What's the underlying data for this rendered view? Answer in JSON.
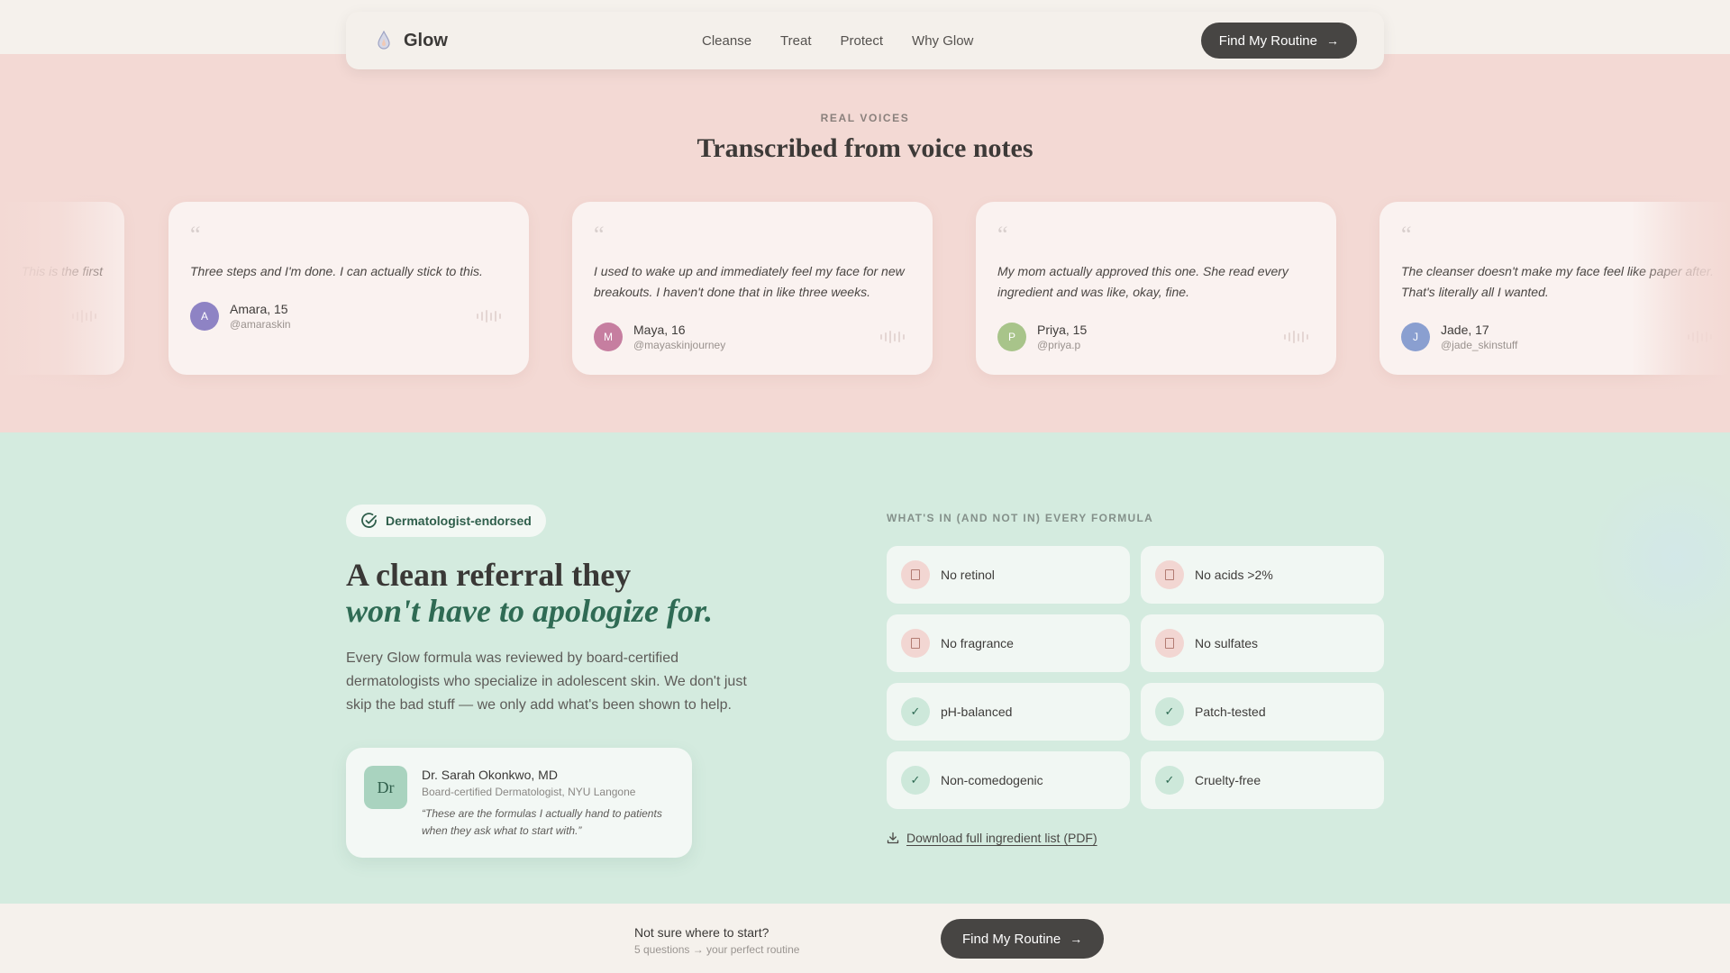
{
  "nav": {
    "brand": "Glow",
    "links": [
      "Cleanse",
      "Treat",
      "Protect",
      "Why Glow"
    ],
    "cta": "Find My Routine"
  },
  "voices": {
    "eyebrow": "REAL VOICES",
    "title": "Transcribed from voice notes",
    "cards": [
      {
        "quote": "This is the first",
        "name": "",
        "handle": "",
        "initial": "",
        "color": "#c98f8a"
      },
      {
        "quote": "Three steps and I'm done. I can actually stick to this.",
        "name": "Amara, 15",
        "handle": "@amaraskin",
        "initial": "A",
        "color": "#8e83c4"
      },
      {
        "quote": "I used to wake up and immediately feel my face for new breakouts. I haven't done that in like three weeks.",
        "name": "Maya, 16",
        "handle": "@mayaskinjourney",
        "initial": "M",
        "color": "#c67ea0"
      },
      {
        "quote": "My mom actually approved this one. She read every ingredient and was like, okay, fine.",
        "name": "Priya, 15",
        "handle": "@priya.p",
        "initial": "P",
        "color": "#a8c48a"
      },
      {
        "quote": "The cleanser doesn't make my face feel like paper after. That's literally all I wanted.",
        "name": "Jade, 17",
        "handle": "@jade_skinstuff",
        "initial": "J",
        "color": "#8a9fd0"
      }
    ]
  },
  "derm": {
    "badge": "Dermatologist-endorsed",
    "title_line1": "A clean referral they",
    "title_line2": "won't have to apologize for.",
    "body": "Every Glow formula was reviewed by board-certified dermatologists who specialize in adolescent skin. We don't just skip the bad stuff — we only add what's been shown to help.",
    "doctor": {
      "initials": "Dr",
      "name": "Dr. Sarah Okonkwo, MD",
      "role": "Board-certified Dermatologist, NYU Langone",
      "quote": "“These are the formulas I actually hand to patients when they ask what to start with.”"
    },
    "formula_eyebrow": "WHAT'S IN (AND NOT IN) EVERY FORMULA",
    "formula": [
      {
        "label": "No retinol",
        "kind": "neg"
      },
      {
        "label": "No acids >2%",
        "kind": "neg"
      },
      {
        "label": "No fragrance",
        "kind": "neg"
      },
      {
        "label": "No sulfates",
        "kind": "neg"
      },
      {
        "label": "pH-balanced",
        "kind": "pos"
      },
      {
        "label": "Patch-tested",
        "kind": "pos"
      },
      {
        "label": "Non-comedogenic",
        "kind": "pos"
      },
      {
        "label": "Cruelty-free",
        "kind": "pos"
      }
    ],
    "download": "Download full ingredient list (PDF)"
  },
  "bottom_bar": {
    "title": "Not sure where to start?",
    "subtitle": "5 questions → your perfect routine",
    "cta": "Find My Routine"
  }
}
